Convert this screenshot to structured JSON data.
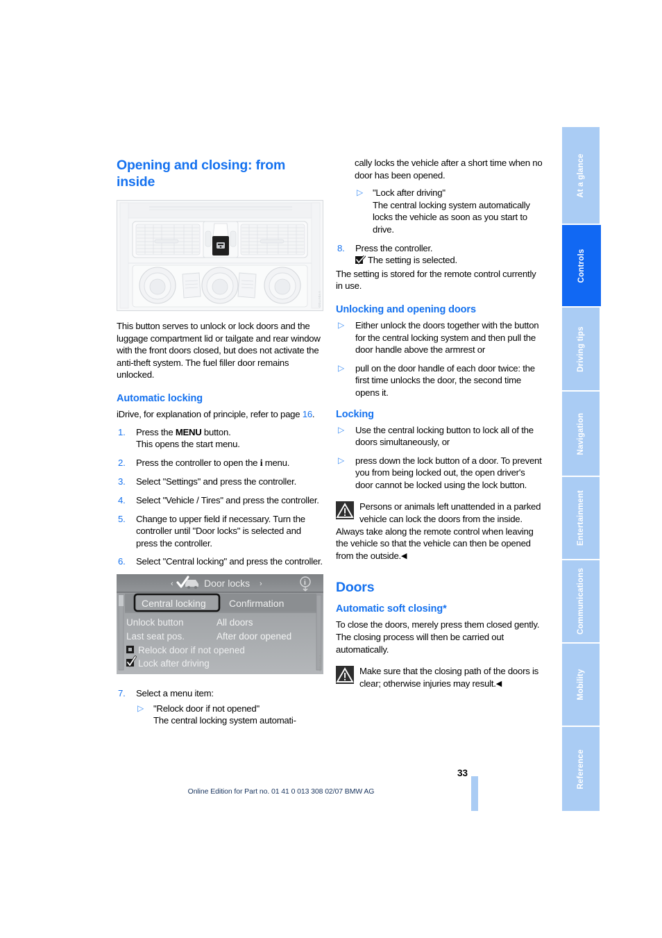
{
  "document": {
    "page_number": "33",
    "footer_edition": "Online Edition for Part no. 01 41 0 013 308 02/07 BMW AG",
    "accent_blue": "#1471ef",
    "tab_inactive": "#aaccf4",
    "tab_active": "#1168f3"
  },
  "tabs": [
    {
      "label": "At a glance",
      "active": false
    },
    {
      "label": "Controls",
      "active": true
    },
    {
      "label": "Driving tips",
      "active": false
    },
    {
      "label": "Navigation",
      "active": false
    },
    {
      "label": "Entertainment",
      "active": false
    },
    {
      "label": "Communications",
      "active": false
    },
    {
      "label": "Mobility",
      "active": false
    },
    {
      "label": "Reference",
      "active": false
    }
  ],
  "left": {
    "title": "Opening and closing: from inside",
    "figure_dashboard": {
      "name": "center-console-air-vents-with-central-locking-button",
      "code": "VY0VTGD"
    },
    "intro": "This button serves to unlock or lock doors and the luggage compartment lid or tailgate and rear window with the front doors closed, but does not activate the anti-theft system. The fuel filler door remains unlocked.",
    "section_auto_locking": {
      "heading": "Automatic locking",
      "lead_before_link": "iDrive, for explanation of principle, refer to page ",
      "lead_link": "16",
      "lead_after_link": ".",
      "steps": [
        {
          "num": "1.",
          "pre": "Press the ",
          "button": "MENU",
          "post": " button.",
          "second_line": "This opens the start menu."
        },
        {
          "num": "2.",
          "pre": "Press the controller to open the ",
          "glyph": "i",
          "post": " menu."
        },
        {
          "num": "3.",
          "text": "Select \"Settings\" and press the controller."
        },
        {
          "num": "4.",
          "text": "Select \"Vehicle / Tires\" and press the controller."
        },
        {
          "num": "5.",
          "text": "Change to upper field if necessary. Turn the controller until \"Door locks\" is selected and press the controller."
        },
        {
          "num": "6.",
          "text": "Select \"Central locking\" and press the controller."
        }
      ],
      "step7": {
        "num": "7.",
        "text": "Select a menu item:",
        "bullets": [
          {
            "title": "\"Relock door if not opened\"",
            "body": "The central locking system automati-"
          }
        ]
      }
    },
    "figure_idrive": {
      "name": "idrive-door-locks-central-locking-screen",
      "code": "VY0VTGD",
      "title_bar": {
        "left_arrow": "‹",
        "check_icon": "check-car-icon",
        "title": "Door locks",
        "right_arrow": "›",
        "right_icon": "info-icon"
      },
      "tabs": [
        {
          "label": "Central locking",
          "selected": true
        },
        {
          "label": "Confirmation",
          "selected": false
        }
      ],
      "rows": [
        {
          "label": "Unlock button",
          "value": "All doors"
        },
        {
          "label": "Last seat pos.",
          "value": "After door opened"
        }
      ],
      "checkboxes": [
        {
          "label": "Relock door if not opened",
          "checked": false
        },
        {
          "label": "Lock after driving",
          "checked": true
        }
      ]
    }
  },
  "right": {
    "continued_text": "cally locks the vehicle after a short time when no door has been opened.",
    "bullet_lock_after_driving": {
      "title": "\"Lock after driving\"",
      "body": "The central locking system automatically locks the vehicle as soon as you start to drive."
    },
    "step8": {
      "num": "8.",
      "text": "Press the controller.",
      "result_icon": "checkbox-checked-icon",
      "result": "The setting is selected."
    },
    "stored_note": "The setting is stored for the remote control currently in use.",
    "section_unlocking": {
      "heading": "Unlocking and opening doors",
      "bullets": [
        "Either unlock the doors together with the button for the central locking system and then pull the door handle above the armrest or",
        "pull on the door handle of each door twice: the first time unlocks the door, the second time opens it."
      ]
    },
    "section_locking": {
      "heading": "Locking",
      "bullets": [
        "Use the central locking button to lock all of the doors simultaneously, or",
        "press down the lock button of a door. To prevent you from being locked out, the open driver's door cannot be locked using the lock button."
      ],
      "warning": {
        "icon": "warning-triangle-icon",
        "text": "Persons or animals left unattended in a parked vehicle can lock the doors from the inside. Always take along the remote control when leaving the vehicle so that the vehicle can then be opened from the outside.",
        "end_mark": "◀"
      }
    },
    "section_doors": {
      "heading": "Doors",
      "subheading": "Automatic soft closing*",
      "body": "To close the doors, merely press them closed gently. The closing process will then be carried out automatically.",
      "warning": {
        "icon": "warning-triangle-icon",
        "text": "Make sure that the closing path of the doors is clear; otherwise injuries may result.",
        "end_mark": "◀"
      }
    }
  }
}
